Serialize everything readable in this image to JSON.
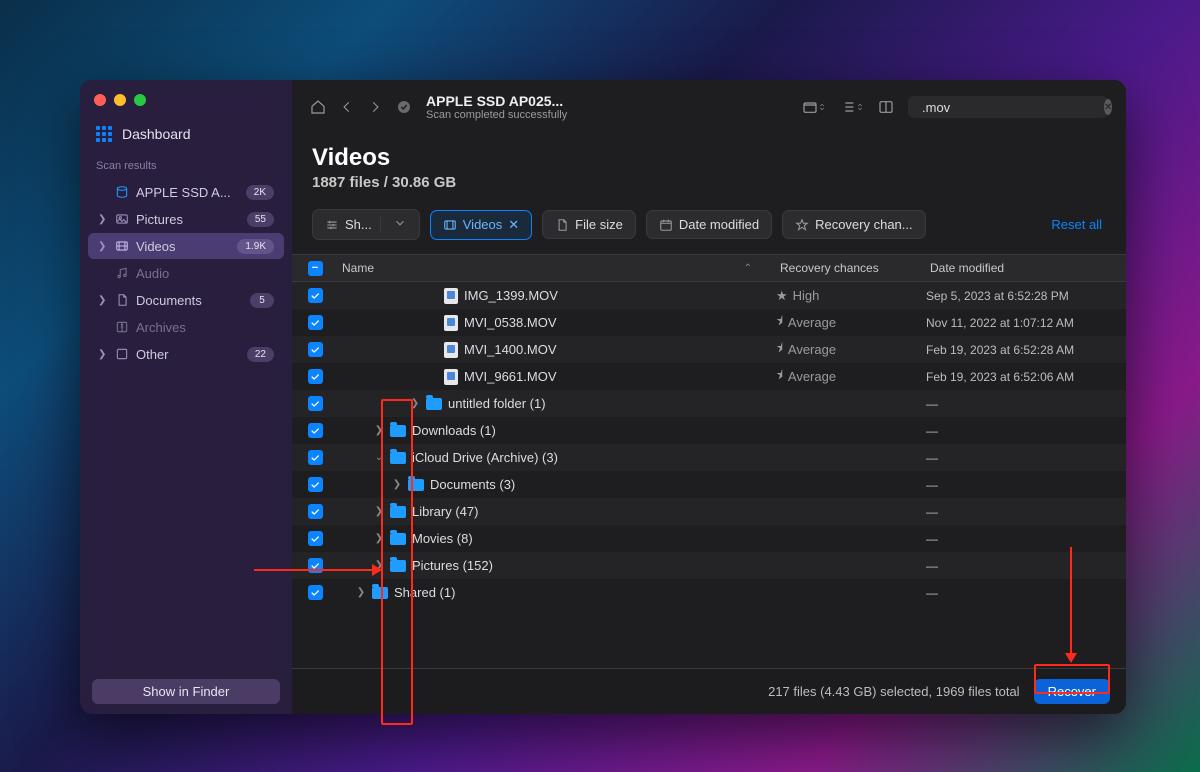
{
  "sidebar": {
    "dashboard": "Dashboard",
    "section_label": "Scan results",
    "items": [
      {
        "label": "APPLE SSD A...",
        "badge": "2K",
        "icon": "disk"
      },
      {
        "label": "Pictures",
        "badge": "55",
        "icon": "pictures"
      },
      {
        "label": "Videos",
        "badge": "1.9K",
        "icon": "videos",
        "active": true
      },
      {
        "label": "Audio",
        "badge": "",
        "icon": "audio",
        "muted": true
      },
      {
        "label": "Documents",
        "badge": "5",
        "icon": "documents"
      },
      {
        "label": "Archives",
        "badge": "",
        "icon": "archives",
        "muted": true
      },
      {
        "label": "Other",
        "badge": "22",
        "icon": "other"
      }
    ],
    "show_finder": "Show in Finder"
  },
  "header": {
    "title": "APPLE SSD AP025...",
    "subtitle": "Scan completed successfully",
    "search_value": ".mov"
  },
  "heading": {
    "title": "Videos",
    "subtitle": "1887 files / 30.86 GB"
  },
  "filters": {
    "show": "Sh...",
    "videos": "Videos",
    "size": "File size",
    "date": "Date modified",
    "recovery": "Recovery chan...",
    "reset": "Reset all"
  },
  "columns": {
    "name": "Name",
    "recovery": "Recovery chances",
    "date": "Date modified"
  },
  "rows": [
    {
      "indent": 5,
      "type": "file",
      "name": "IMG_1399.MOV",
      "rec": "High",
      "rec_star": "full",
      "date": "Sep 5, 2023 at 6:52:28 PM"
    },
    {
      "indent": 5,
      "type": "file",
      "name": "MVI_0538.MOV",
      "rec": "Average",
      "rec_star": "half",
      "date": "Nov 11, 2022 at 1:07:12 AM"
    },
    {
      "indent": 5,
      "type": "file",
      "name": "MVI_1400.MOV",
      "rec": "Average",
      "rec_star": "half",
      "date": "Feb 19, 2023 at 6:52:28 AM"
    },
    {
      "indent": 5,
      "type": "file",
      "name": "MVI_9661.MOV",
      "rec": "Average",
      "rec_star": "half",
      "date": "Feb 19, 2023 at 6:52:06 AM"
    },
    {
      "indent": 4,
      "type": "folder",
      "chev": "right",
      "name": "untitled folder (1)",
      "date": "—"
    },
    {
      "indent": 2,
      "type": "folder",
      "chev": "right",
      "name": "Downloads (1)",
      "date": "—"
    },
    {
      "indent": 2,
      "type": "folder",
      "chev": "down",
      "name": "iCloud Drive (Archive) (3)",
      "date": "—"
    },
    {
      "indent": 3,
      "type": "folder",
      "chev": "right",
      "name": "Documents (3)",
      "date": "—"
    },
    {
      "indent": 2,
      "type": "folder",
      "chev": "right",
      "name": "Library (47)",
      "date": "—"
    },
    {
      "indent": 2,
      "type": "folder",
      "chev": "right",
      "name": "Movies (8)",
      "date": "—"
    },
    {
      "indent": 2,
      "type": "folder",
      "chev": "right",
      "name": "Pictures (152)",
      "date": "—"
    },
    {
      "indent": 1,
      "type": "folder",
      "chev": "right",
      "name": "Shared (1)",
      "date": "—"
    }
  ],
  "status": {
    "text": "217 files (4.43 GB) selected, 1969 files total",
    "button": "Recover"
  }
}
